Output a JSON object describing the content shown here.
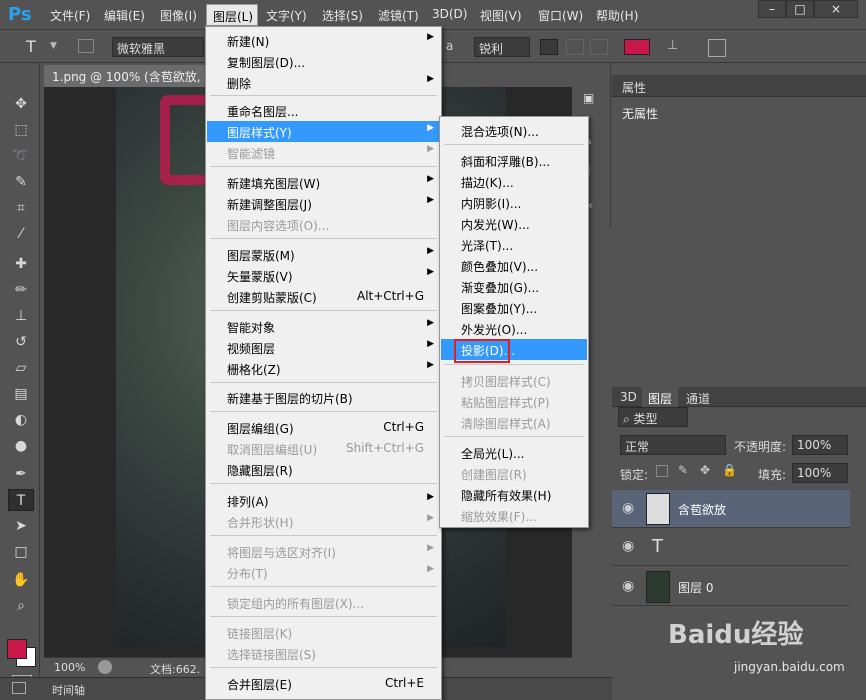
{
  "app": {
    "logo": "Ps"
  },
  "menubar": {
    "items": [
      "文件(F)",
      "编辑(E)",
      "图像(I)",
      "图层(L)",
      "文字(Y)",
      "选择(S)",
      "滤镜(T)",
      "3D(D)",
      "视图(V)",
      "窗口(W)",
      "帮助(H)"
    ],
    "window_buttons": [
      "–",
      "□",
      "×"
    ]
  },
  "options": {
    "tool_glyph": "T",
    "font_family": "微软雅黑",
    "aa_label": "a",
    "antialias": "锐利"
  },
  "document": {
    "tab_title": "1.png @ 100% (含苞欲放, R",
    "zoom": "100%",
    "doc_label": "文档:662.",
    "timeline_label": "时间轴"
  },
  "layer_menu": {
    "items": [
      {
        "label": "新建(N)",
        "arrow": "▶"
      },
      {
        "label": "复制图层(D)..."
      },
      {
        "label": "删除",
        "arrow": "▶"
      },
      {
        "label": "重命名图层..."
      },
      {
        "label": "图层样式(Y)",
        "arrow": "▶",
        "highlight": true
      },
      {
        "label": "智能滤镜",
        "arrow": "▶",
        "disabled": true
      },
      {
        "label": "新建填充图层(W)",
        "arrow": "▶"
      },
      {
        "label": "新建调整图层(J)",
        "arrow": "▶"
      },
      {
        "label": "图层内容选项(O)...",
        "disabled": true
      },
      {
        "label": "图层蒙版(M)",
        "arrow": "▶"
      },
      {
        "label": "矢量蒙版(V)",
        "arrow": "▶"
      },
      {
        "label": "创建剪贴蒙版(C)",
        "shortcut": "Alt+Ctrl+G"
      },
      {
        "label": "智能对象",
        "arrow": "▶"
      },
      {
        "label": "视频图层",
        "arrow": "▶"
      },
      {
        "label": "栅格化(Z)",
        "arrow": "▶"
      },
      {
        "label": "新建基于图层的切片(B)"
      },
      {
        "label": "图层编组(G)",
        "shortcut": "Ctrl+G"
      },
      {
        "label": "取消图层编组(U)",
        "shortcut": "Shift+Ctrl+G",
        "disabled": true
      },
      {
        "label": "隐藏图层(R)"
      },
      {
        "label": "排列(A)",
        "arrow": "▶"
      },
      {
        "label": "合并形状(H)",
        "arrow": "▶",
        "disabled": true
      },
      {
        "label": "将图层与选区对齐(I)",
        "arrow": "▶",
        "disabled": true
      },
      {
        "label": "分布(T)",
        "arrow": "▶",
        "disabled": true
      },
      {
        "label": "锁定组内的所有图层(X)...",
        "disabled": true
      },
      {
        "label": "链接图层(K)",
        "disabled": true
      },
      {
        "label": "选择链接图层(S)",
        "disabled": true
      },
      {
        "label": "合并图层(E)",
        "shortcut": "Ctrl+E"
      }
    ]
  },
  "style_submenu": {
    "items": [
      {
        "label": "混合选项(N)..."
      },
      {
        "label": "斜面和浮雕(B)..."
      },
      {
        "label": "描边(K)..."
      },
      {
        "label": "内阴影(I)..."
      },
      {
        "label": "内发光(W)..."
      },
      {
        "label": "光泽(T)..."
      },
      {
        "label": "颜色叠加(V)..."
      },
      {
        "label": "渐变叠加(G)..."
      },
      {
        "label": "图案叠加(Y)..."
      },
      {
        "label": "外发光(O)..."
      },
      {
        "label": "投影(D)...",
        "highlight": true
      },
      {
        "label": "拷贝图层样式(C)",
        "disabled": true
      },
      {
        "label": "粘贴图层样式(P)",
        "disabled": true
      },
      {
        "label": "清除图层样式(A)",
        "disabled": true
      },
      {
        "label": "全局光(L)..."
      },
      {
        "label": "创建图层(R)",
        "disabled": true
      },
      {
        "label": "隐藏所有效果(H)"
      },
      {
        "label": "缩放效果(F)...",
        "disabled": true
      }
    ]
  },
  "properties": {
    "tab": "属性",
    "empty_text": "无属性"
  },
  "layers_panel": {
    "tabs": [
      "3D",
      "图层",
      "通道"
    ],
    "filter_label": "类型",
    "blend_mode": "正常",
    "opacity_label": "不透明度:",
    "opacity_value": "100%",
    "lock_label": "锁定:",
    "fill_label": "填充:",
    "fill_value": "100%",
    "layers": [
      {
        "name": "含苞欲放",
        "type": "text",
        "selected": true
      },
      {
        "name": "",
        "type": "text-icon"
      },
      {
        "name": "图层 0",
        "type": "image"
      }
    ]
  },
  "watermark": {
    "brand": "Baidu经验",
    "url": "jingyan.baidu.com"
  },
  "colors": {
    "foreground": "#c8184a",
    "background": "#ffffff",
    "menu_highlight": "#3399ff",
    "shadow_box": "#e02020"
  }
}
